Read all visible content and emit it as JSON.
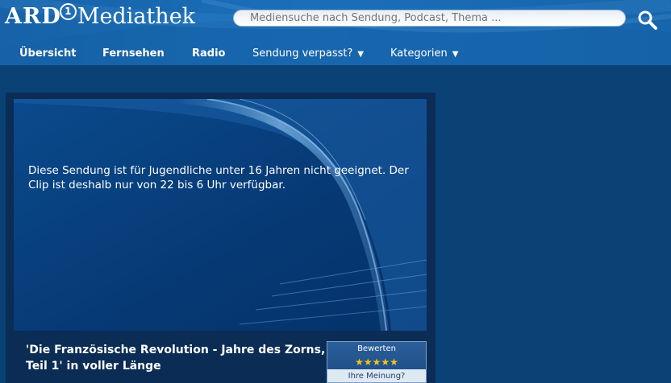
{
  "header": {
    "logo": {
      "brand": "ARD",
      "one": "1",
      "product": "Mediathek"
    },
    "search": {
      "placeholder": "Mediensuche nach Sendung, Podcast, Thema ..."
    }
  },
  "nav": {
    "items": [
      {
        "label": "Übersicht"
      },
      {
        "label": "Fernsehen"
      },
      {
        "label": "Radio"
      },
      {
        "label": "Sendung verpasst?",
        "caret": "▼"
      },
      {
        "label": "Kategorien",
        "caret": "▼"
      }
    ]
  },
  "player": {
    "message": "Diese Sendung ist für Jugendliche unter 16 Jahren nicht geeignet. Der Clip ist deshalb nur von 22 bis 6 Uhr verfügbar.",
    "title": "'Die Französische Revolution - Jahre des Zorns, Teil 1' in voller Länge"
  },
  "rating": {
    "title": "Bewerten",
    "stars": "★★★★★",
    "opinion": "Ihre Meinung?"
  },
  "colors": {
    "page_bg": "#0a4276",
    "header_bg": "#1a6fb9",
    "star": "#f4c21c"
  }
}
